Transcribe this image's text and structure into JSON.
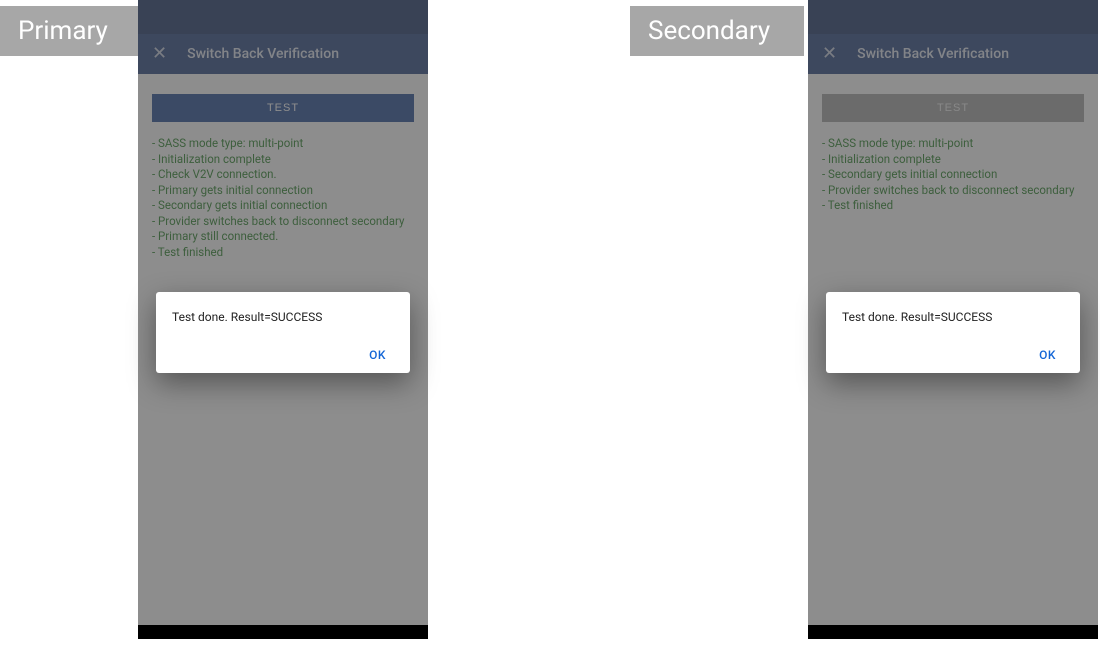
{
  "labels": {
    "primary": "Primary",
    "secondary": "Secondary"
  },
  "left": {
    "app_title": "Switch Back Verification",
    "test_button": "TEST",
    "test_button_style": "blue",
    "log": [
      "- SASS mode type: multi-point",
      "- Initialization complete",
      "- Check V2V connection.",
      "- Primary gets initial connection",
      "- Secondary gets initial connection",
      "- Provider switches back to disconnect secondary",
      "- Primary still connected.",
      "- Test finished"
    ],
    "dialog": {
      "text": "Test done. Result=SUCCESS",
      "ok": "OK"
    }
  },
  "right": {
    "app_title": "Switch Back Verification",
    "test_button": "TEST",
    "test_button_style": "grey",
    "log": [
      "- SASS mode type: multi-point",
      "- Initialization complete",
      "- Secondary gets initial connection",
      "- Provider switches back to disconnect secondary",
      "- Test finished"
    ],
    "dialog": {
      "text": "Test done. Result=SUCCESS",
      "ok": "OK"
    }
  }
}
